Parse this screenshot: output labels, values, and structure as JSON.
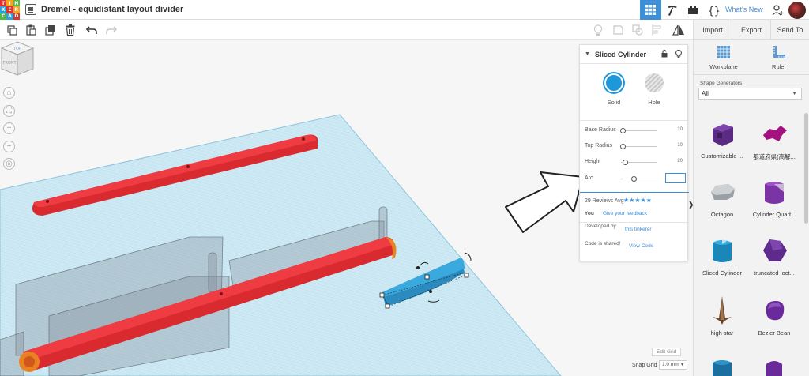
{
  "app": {
    "logo_letters": [
      "T",
      "I",
      "N",
      "K",
      "E",
      "R",
      "C",
      "A",
      "D"
    ],
    "logo_colors": [
      "#e2312a",
      "#f6a41e",
      "#55b948",
      "#2ba4dd",
      "#e2312a",
      "#f6a41e",
      "#55b948",
      "#2ba4dd",
      "#e2312a"
    ],
    "document_title": "Dremel - equidistant layout divider",
    "whats_new": "What's New",
    "accent": "#3d8fd6"
  },
  "toolbar": {
    "tools": [
      "copy-icon",
      "paste-icon",
      "duplicate-icon",
      "delete-icon",
      "undo-icon",
      "redo-icon"
    ],
    "view_tools": [
      "light-bulb-icon",
      "note-icon",
      "group-icon",
      "align-icon",
      "mirror-icon"
    ],
    "import": "Import",
    "export": "Export",
    "send_to": "Send To"
  },
  "navcube": {
    "top": "TOP",
    "front": "FRONT"
  },
  "inspector": {
    "title": "Sliced Cylinder",
    "solid": "Solid",
    "hole": "Hole",
    "params": [
      {
        "label": "Base Radius",
        "value": "10",
        "knob": 0.05
      },
      {
        "label": "Top Radius",
        "value": "10",
        "knob": 0.05
      },
      {
        "label": "Height",
        "value": "20",
        "knob": 0.1
      },
      {
        "label": "Arc",
        "value": "",
        "knob": 0.35
      }
    ],
    "reviews": "29 Reviews Avg",
    "stars": "★★★★★",
    "you": "You",
    "feedback": "Give your feedback",
    "developed_by": "Developed by",
    "developer": "this tinkerer",
    "code_shared": "Code is shared!",
    "view_code": "View Code"
  },
  "right_panel": {
    "workplane": "Workplane",
    "ruler": "Ruler",
    "shape_generators_label": "Shape Generators",
    "shape_generators_value": "All",
    "shapes": [
      {
        "name": "Customizable ...",
        "icon": "customizable-icon"
      },
      {
        "name": "都道府県(高解...",
        "icon": "prefecture-icon"
      },
      {
        "name": "Octagon",
        "icon": "octagon-icon"
      },
      {
        "name": "Cylinder Quart...",
        "icon": "cylinder-quarter-icon"
      },
      {
        "name": "Sliced Cylinder",
        "icon": "sliced-cylinder-icon"
      },
      {
        "name": "truncated_oct...",
        "icon": "truncated-octahedron-icon"
      },
      {
        "name": "high star",
        "icon": "high-star-icon"
      },
      {
        "name": "Bezier Bean",
        "icon": "bezier-bean-icon"
      }
    ]
  },
  "grid": {
    "edit_grid": "Edit Grid",
    "snap_grid": "Snap Grid",
    "snap_value": "1.0 mm"
  }
}
